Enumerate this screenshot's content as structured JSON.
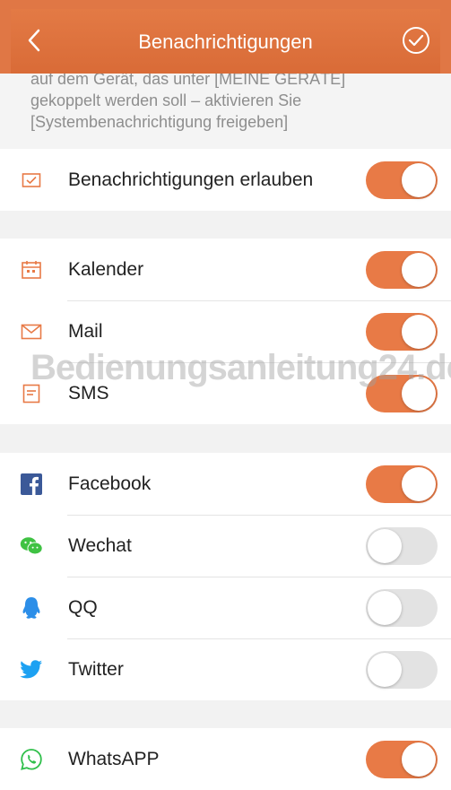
{
  "header": {
    "title": "Benachrichtigungen",
    "back_icon": "chevron-left-icon",
    "confirm_icon": "check-circle-icon"
  },
  "intro": {
    "lines": [
      "auf dem Gerät, das unter [MEINE GERÄTE]",
      "gekoppelt werden soll – aktivieren Sie",
      "[Systembenachrichtigung freigeben]"
    ]
  },
  "groups": [
    {
      "rows": [
        {
          "label": "Benachrichtigungen erlauben",
          "icon": "envelope-check-icon",
          "enabled": true
        }
      ]
    },
    {
      "rows": [
        {
          "label": "Kalender",
          "icon": "calendar-icon",
          "enabled": true
        },
        {
          "label": "Mail",
          "icon": "mail-icon",
          "enabled": true
        },
        {
          "label": "SMS",
          "icon": "sms-icon",
          "enabled": true
        }
      ]
    },
    {
      "rows": [
        {
          "label": "Facebook",
          "icon": "facebook-icon",
          "enabled": true
        },
        {
          "label": "Wechat",
          "icon": "wechat-icon",
          "enabled": false
        },
        {
          "label": "QQ",
          "icon": "qq-icon",
          "enabled": false
        },
        {
          "label": "Twitter",
          "icon": "twitter-icon",
          "enabled": false
        }
      ]
    },
    {
      "rows": [
        {
          "label": "WhatsAPP",
          "icon": "whatsapp-icon",
          "enabled": true
        }
      ]
    }
  ],
  "watermark": "Bedienungsanleitung24.de",
  "colors": {
    "accent": "#e87a46",
    "toggle_off": "#e3e3e3",
    "facebook": "#3b5998",
    "wechat": "#3fc243",
    "qq": "#2c8ee8",
    "twitter": "#1da1f2",
    "whatsapp": "#2fbf4a"
  }
}
